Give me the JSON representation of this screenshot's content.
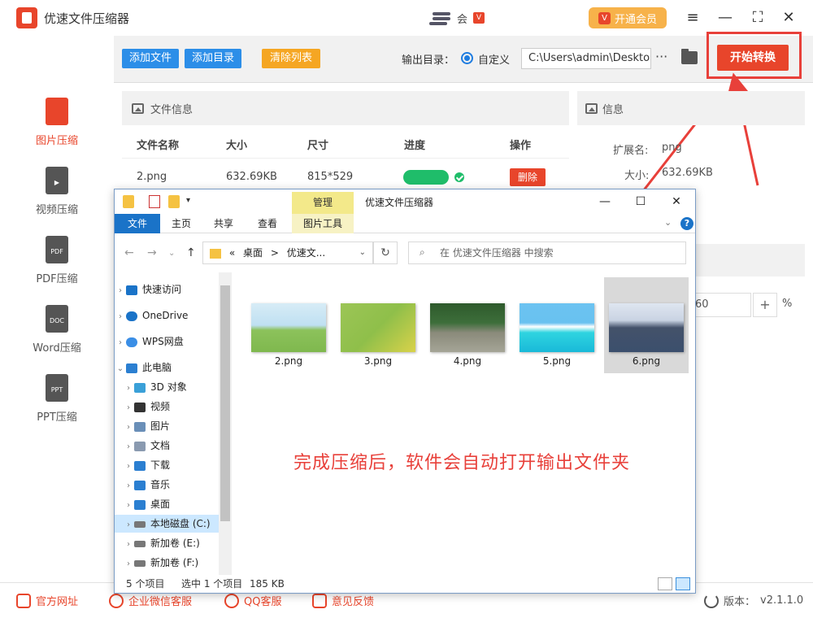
{
  "app": {
    "title": "优速文件压缩器",
    "username": "会",
    "vip_button": "开通会员"
  },
  "sidebar": {
    "items": [
      {
        "label": "图片压缩",
        "icon": "image-file-icon",
        "active": true
      },
      {
        "label": "视频压缩",
        "icon": "video-file-icon"
      },
      {
        "label": "PDF压缩",
        "icon": "pdf-file-icon",
        "badge": "PDF"
      },
      {
        "label": "Word压缩",
        "icon": "doc-file-icon",
        "badge": "DOC"
      },
      {
        "label": "PPT压缩",
        "icon": "ppt-file-icon",
        "badge": "PPT"
      }
    ]
  },
  "toolbar": {
    "add_file": "添加文件",
    "add_dir": "添加目录",
    "clear_list": "清除列表",
    "output_label": "输出目录：",
    "custom_label": "自定义",
    "output_path": "C:\\Users\\admin\\Deskto",
    "more": "···",
    "start": "开始转换"
  },
  "file_panel": {
    "title": "文件信息",
    "columns": [
      "文件名称",
      "大小",
      "尺寸",
      "进度",
      "操作"
    ],
    "rows": [
      {
        "name": "2.png",
        "size": "632.69KB",
        "dimensions": "815*529",
        "progress": 1.0,
        "action": "删除"
      }
    ]
  },
  "info_panel": {
    "title": "信息",
    "ext_label": "扩展名:",
    "ext_value": "png",
    "size_label": "大小:",
    "size_value": "632.69KB",
    "quality_value": "60",
    "plus": "+",
    "percent": "%"
  },
  "explorer": {
    "manage_tab": "管理",
    "title": "优速文件压缩器",
    "ribbon_tabs": [
      "文件",
      "主页",
      "共享",
      "查看",
      "图片工具"
    ],
    "address": [
      "«",
      "桌面",
      ">",
      "优速文..."
    ],
    "search_placeholder": "在 优速文件压缩器 中搜索",
    "tree": [
      {
        "label": "快速访问",
        "icon": "star-icon",
        "level": 0
      },
      {
        "label": "OneDrive",
        "icon": "cloud-icon",
        "level": 0
      },
      {
        "label": "WPS网盘",
        "icon": "wps-cloud-icon",
        "level": 0
      },
      {
        "label": "此电脑",
        "icon": "computer-icon",
        "level": 0,
        "expanded": true
      },
      {
        "label": "3D 对象",
        "icon": "3d-objects-icon",
        "level": 1
      },
      {
        "label": "视频",
        "icon": "video-folder-icon",
        "level": 1
      },
      {
        "label": "图片",
        "icon": "pictures-folder-icon",
        "level": 1
      },
      {
        "label": "文档",
        "icon": "documents-folder-icon",
        "level": 1
      },
      {
        "label": "下载",
        "icon": "download-icon",
        "level": 1
      },
      {
        "label": "音乐",
        "icon": "music-icon",
        "level": 1
      },
      {
        "label": "桌面",
        "icon": "desktop-icon",
        "level": 1
      },
      {
        "label": "本地磁盘 (C:)",
        "icon": "drive-icon",
        "level": 1,
        "selected": true
      },
      {
        "label": "新加卷 (E:)",
        "icon": "drive-icon",
        "level": 1
      },
      {
        "label": "新加卷 (F:)",
        "icon": "drive-icon",
        "level": 1
      }
    ],
    "files": [
      {
        "name": "2.png",
        "colors": [
          "#bfe0f2",
          "#7fb84e"
        ]
      },
      {
        "name": "3.png",
        "colors": [
          "#8fbf4a",
          "#d9d24a"
        ]
      },
      {
        "name": "4.png",
        "colors": [
          "#3d6e3a",
          "#9a9a8a"
        ]
      },
      {
        "name": "5.png",
        "colors": [
          "#68c1f0",
          "#2fd4e0"
        ]
      },
      {
        "name": "6.png",
        "colors": [
          "#c9d3e3",
          "#3b4f6d"
        ],
        "selected": true
      }
    ],
    "status_count": "5 个项目",
    "status_selected": "选中 1 个项目",
    "status_size": "185 KB",
    "notice": "完成压缩后，软件会自动打开输出文件夹"
  },
  "footer": {
    "items": [
      "官方网址",
      "企业微信客服",
      "QQ客服",
      "意见反馈"
    ],
    "version_label": "版本：",
    "version": "v2.1.1.0"
  },
  "colors": {
    "accent_red": "#e8452b",
    "blue_button": "#2c8ee8",
    "orange_button": "#f5a623",
    "progress_green": "#1fbd6a"
  }
}
